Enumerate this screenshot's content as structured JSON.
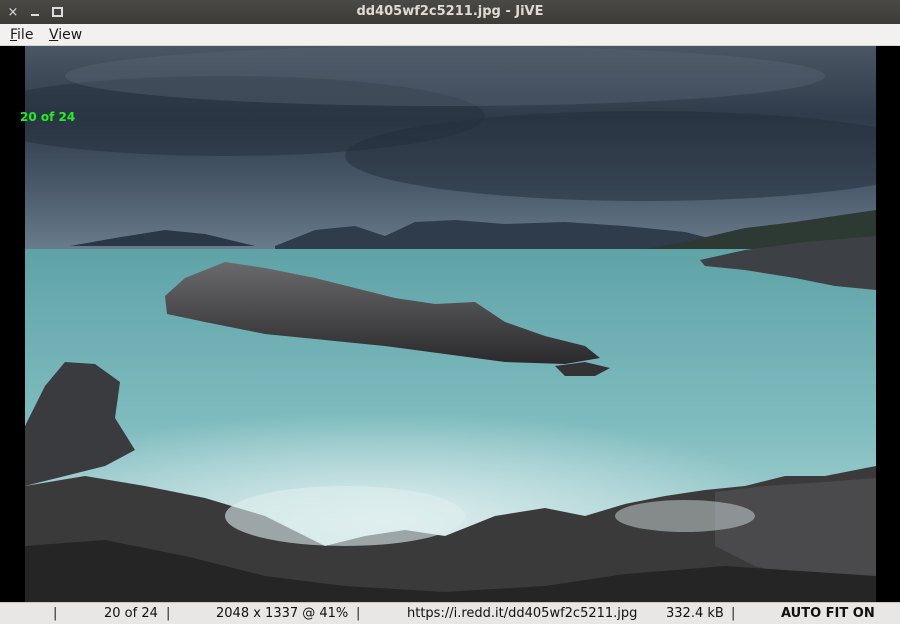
{
  "window": {
    "title": "dd405wf2c5211.jpg - JiVE",
    "close_glyph": "×"
  },
  "menu": {
    "file": {
      "mnemonic": "F",
      "rest": "ile"
    },
    "view": {
      "mnemonic": "V",
      "rest": "iew"
    }
  },
  "viewer": {
    "overlay_counter": "20 of 24",
    "overlay_color": "#22ee22",
    "image_description_colors": {
      "sky": "#3b4a5a",
      "sea": "#6fb3b6",
      "rocks": "#3a3a3c"
    }
  },
  "status": {
    "separator": "|",
    "counter": "20 of 24",
    "dimensions": "2048 x 1337 @ 41%",
    "url": "https://i.redd.it/dd405wf2c5211.jpg",
    "size": "332.4 kB",
    "fit_mode": "AUTO FIT ON"
  }
}
